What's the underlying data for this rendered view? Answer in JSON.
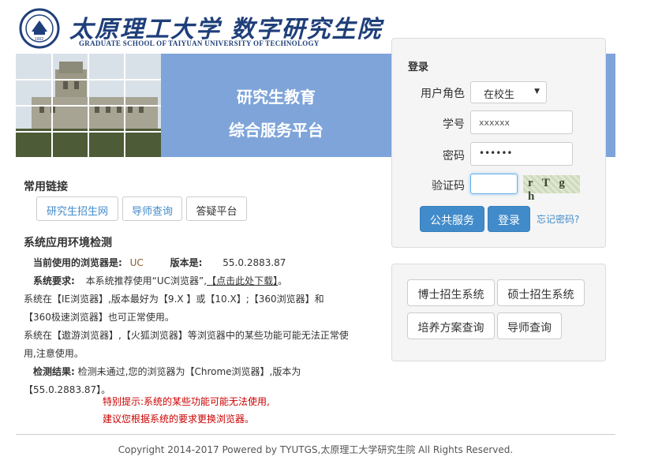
{
  "header": {
    "brand_cn": "太原理工大学 数字研究生院",
    "brand_en": "GRADUATE SCHOOL OF TAIYUAN UNIVERSITY OF TECHNOLOGY",
    "logo_year": "1902"
  },
  "banner": {
    "line1": "研究生教育",
    "line2": "综合服务平台"
  },
  "login": {
    "title": "登录",
    "role_label": "用户角色",
    "role_value": "在校生",
    "id_label": "学号",
    "id_value": "xxxxxx",
    "pwd_label": "密码",
    "pwd_value": "••••••",
    "captcha_label": "验证码",
    "captcha_text": "r T g h",
    "public_service": "公共服务",
    "login_button": "登录",
    "forgot": "忘记密码?"
  },
  "systems": {
    "doctor": "博士招生系统",
    "master": "硕士招生系统",
    "training": "培养方案查询",
    "advisor": "导师查询"
  },
  "links": {
    "title": "常用链接",
    "items": [
      "研究生招生网",
      "导师查询",
      "答疑平台"
    ]
  },
  "env": {
    "title": "系统应用环境检测",
    "current_label": "当前使用的浏览器是:",
    "current_value": "UC",
    "version_label": "版本是:",
    "version_value": "55.0.2883.87",
    "req_label": "系统要求:",
    "req_text": "本系统推荐使用“UC浏览器”,",
    "req_link": "【点击此处下载】",
    "req_end": "。",
    "line3": "系统在【IE浏览器】,版本最好为【9.X 】或【10.X】;【360浏览器】和",
    "line4": "【360极速浏览器】也可正常使用。",
    "line5": "系统在【遨游浏览器】,【火狐浏览器】等浏览器中的某些功能可能无法正常使",
    "line6": "用,注意使用。",
    "result_label": "检测结果:",
    "result_text": "检测未通过,您的浏览器为【Chrome浏览器】,版本为",
    "result_version": "【55.0.2883.87】。",
    "warn1": "特别提示:系统的某些功能可能无法使用,",
    "warn2": "建议您根据系统的要求更换浏览器。"
  },
  "footer": {
    "copyright": "Copyright 2014-2017 Powered by TYUTGS,太原理工大学研究生院 All Rights Reserved."
  },
  "colors": {
    "primary": "#428bca",
    "banner": "#7ea4d9",
    "brand": "#1f3f7a",
    "warning": "#cc0000"
  }
}
